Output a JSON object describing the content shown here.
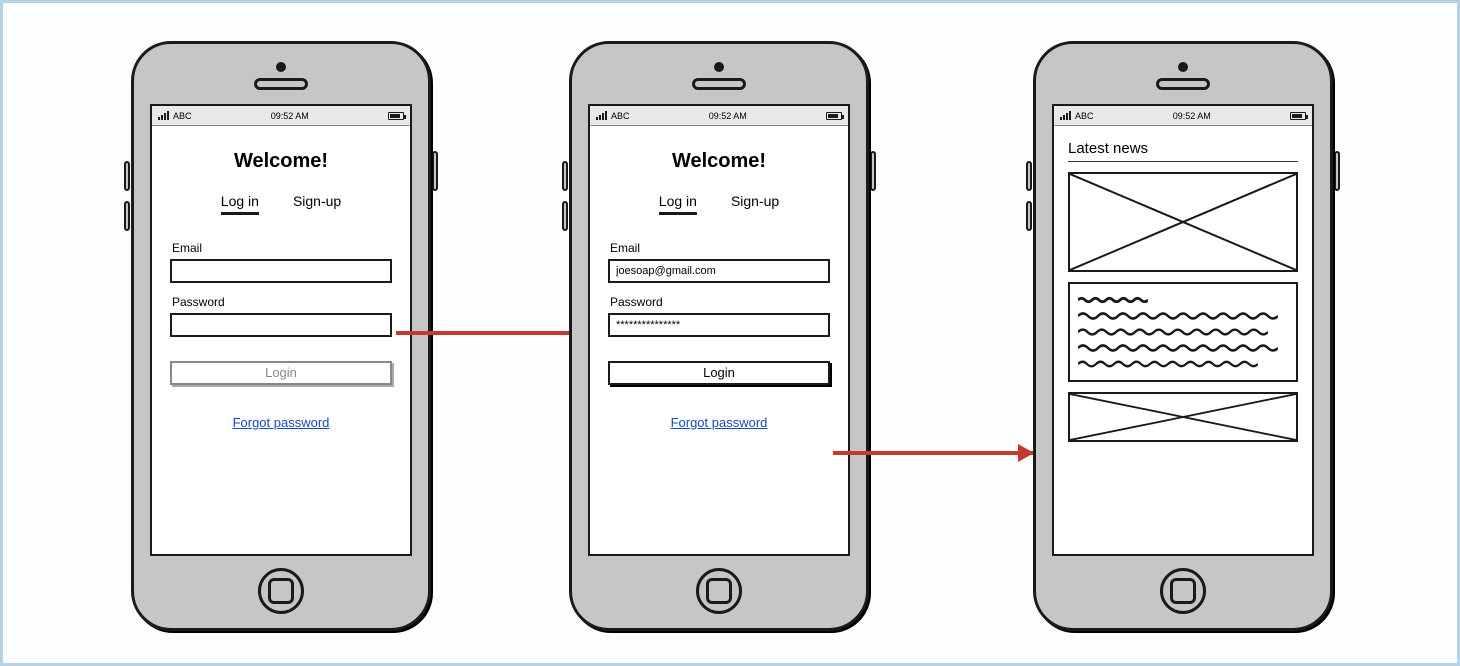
{
  "status": {
    "carrier": "ABC",
    "time": "09:52 AM"
  },
  "login": {
    "title": "Welcome!",
    "tab_login": "Log in",
    "tab_signup": "Sign-up",
    "email_label": "Email",
    "password_label": "Password",
    "login_button": "Login",
    "forgot": "Forgot password"
  },
  "filled": {
    "email_value": "joesoap@gmail.com",
    "password_value": "***************"
  },
  "news": {
    "title": "Latest news"
  }
}
